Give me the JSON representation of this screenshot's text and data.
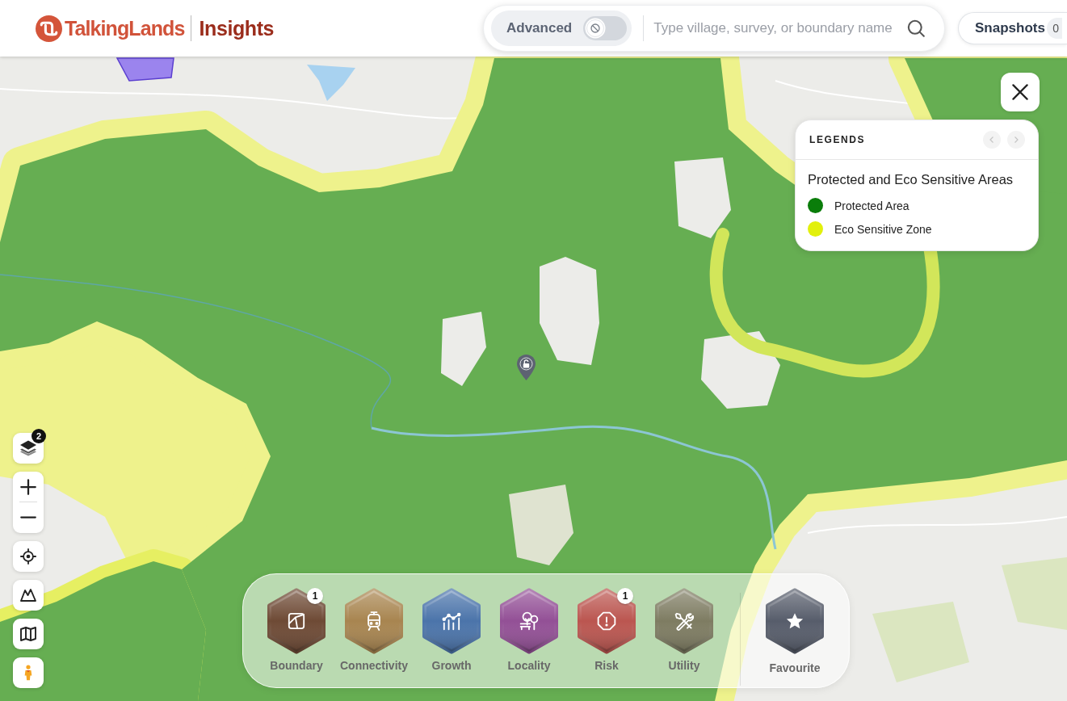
{
  "header": {
    "logo": {
      "brand": "TalkingLands",
      "product": "Insights"
    },
    "search": {
      "advanced": {
        "label": "Advanced",
        "on": false
      },
      "placeholder": "Type village, survey, or boundary name"
    },
    "snapshots": {
      "label": "Snapshots",
      "count": "0"
    }
  },
  "map_controls": [
    {
      "kind": "layers",
      "badge": "2"
    },
    {
      "kind": "zoom"
    },
    {
      "kind": "locate"
    },
    {
      "kind": "terrain"
    },
    {
      "kind": "map"
    },
    {
      "kind": "street_view"
    }
  ],
  "legend": {
    "heading": "LEGENDS",
    "title": "Protected and Eco Sensitive Areas",
    "items": [
      {
        "label": "Protected Area",
        "color": "#0a7d0a"
      },
      {
        "label": "Eco Sensitive Zone",
        "color": "#e2f00c"
      }
    ]
  },
  "categories": [
    {
      "kind": "boundary",
      "label": "Boundary",
      "badge": "1",
      "color": "#6e4a35"
    },
    {
      "kind": "connectivity",
      "label": "Connectivity",
      "color": "#a88550"
    },
    {
      "kind": "growth",
      "label": "Growth",
      "color": "#4b74aa"
    },
    {
      "kind": "locality",
      "label": "Locality",
      "color": "#935096"
    },
    {
      "kind": "risk",
      "label": "Risk",
      "badge": "1",
      "color": "#bb5650"
    },
    {
      "kind": "utility",
      "label": "Utility",
      "color": "#7e7c62"
    }
  ],
  "favourite": {
    "label": "Favourite",
    "color": "#575d6b"
  }
}
